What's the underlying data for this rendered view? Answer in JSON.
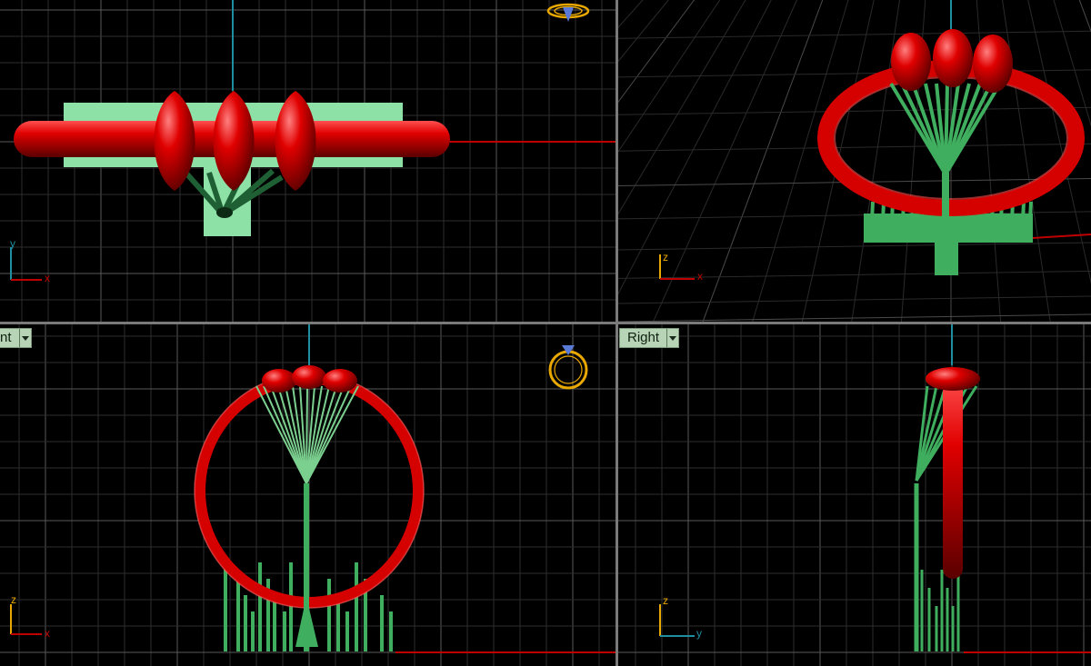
{
  "viewports": {
    "top": {
      "axis_v": "y",
      "axis_h": "x"
    },
    "perspective": {
      "axis_v": "z",
      "axis_h": "x"
    },
    "front": {
      "label": "nt",
      "axis_v": "z",
      "axis_h": "x"
    },
    "right": {
      "label": "Right",
      "axis_v": "z",
      "axis_h": "y"
    }
  },
  "colors": {
    "background": "#000000",
    "grid_minor": "#2c2c2c",
    "grid_major": "#5a5a5a",
    "ring_red": "#d50000",
    "support_green": "#3fae5e",
    "support_plate": "#8de0a6",
    "axis_x": "#c00000",
    "axis_y": "#00a000",
    "axis_z": "#1e8ea0",
    "label_bg": "#b7d4b7",
    "ring_icon": "#e8a800"
  },
  "icons": {
    "top_ring_icon": "ring-icon",
    "front_ring_icon": "ring-icon",
    "viewport_menu": "chevron-down-icon"
  }
}
